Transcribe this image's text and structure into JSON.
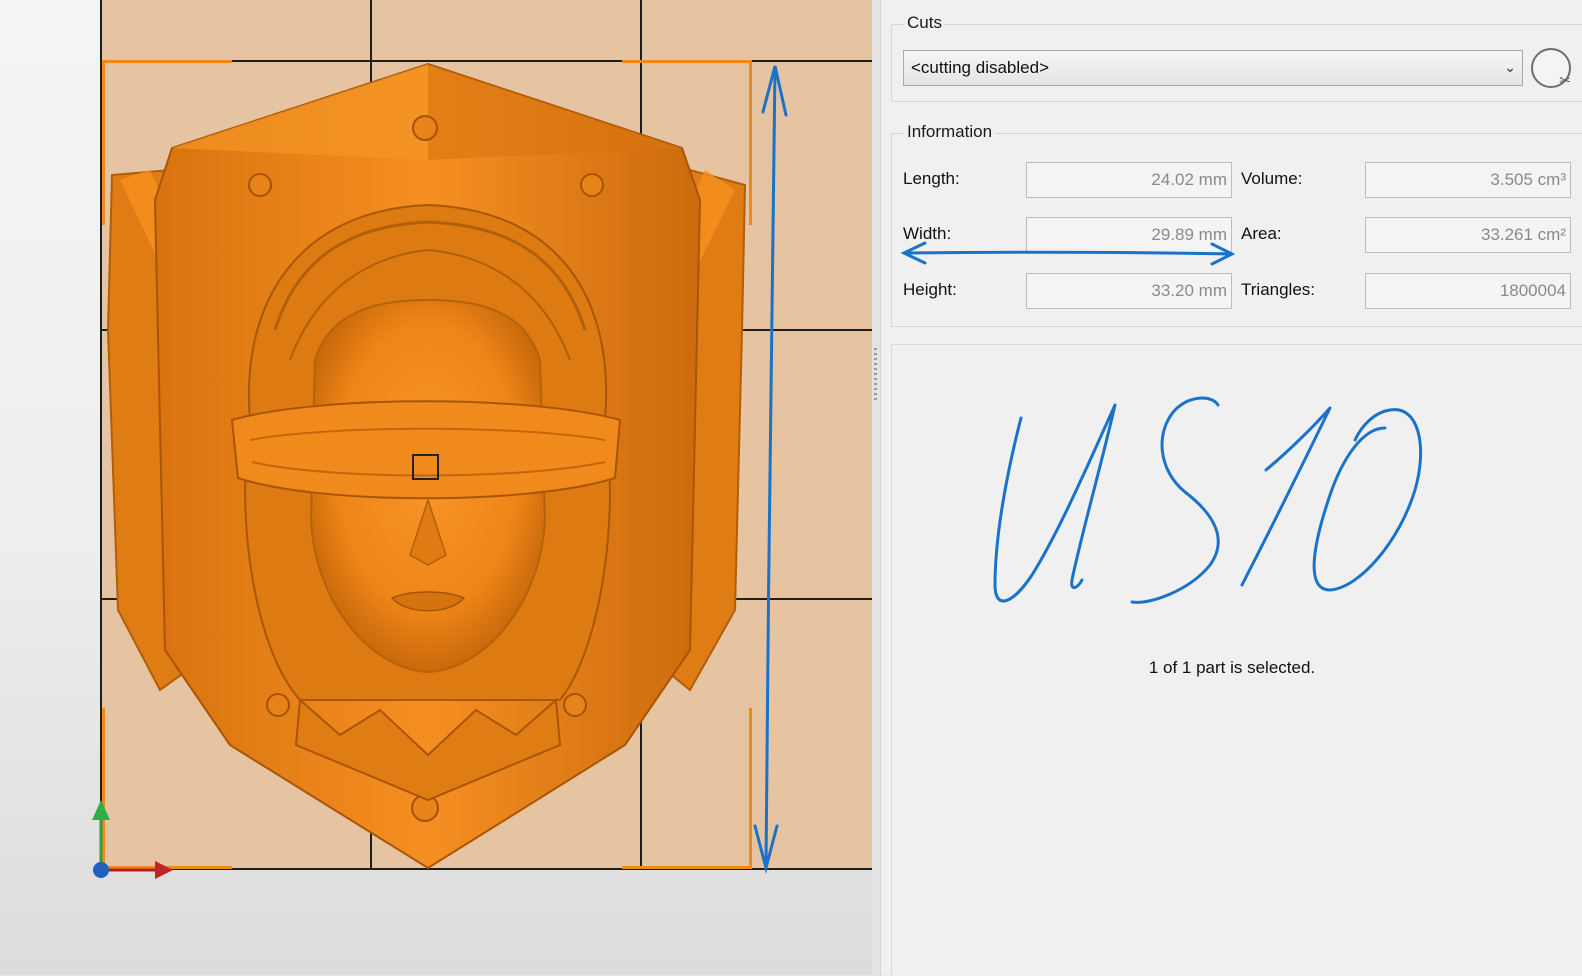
{
  "cuts": {
    "group_title": "Cuts",
    "selected_option": "<cutting disabled>",
    "dropdown_icon": "chevron-down-icon",
    "tool_icon": "cut-tool-icon"
  },
  "information": {
    "group_title": "Information",
    "fields": [
      {
        "label": "Length:",
        "value": "24.02 mm"
      },
      {
        "label": "Volume:",
        "value": "3.505 cm³"
      },
      {
        "label": "Width:",
        "value": "29.89 mm"
      },
      {
        "label": "Area:",
        "value": "33.261 cm²"
      },
      {
        "label": "Height:",
        "value": "33.20 mm"
      },
      {
        "label": "Triangles:",
        "value": "1800004"
      }
    ]
  },
  "handwritten_note": "US10",
  "status": "1 of 1 part is selected.",
  "colors": {
    "model": "#f0891a",
    "model_dark": "#c86a0c",
    "build_plate": "#e7c4a1",
    "annotation_ink": "#1a73c9",
    "bounding_box": "#f0891a"
  }
}
